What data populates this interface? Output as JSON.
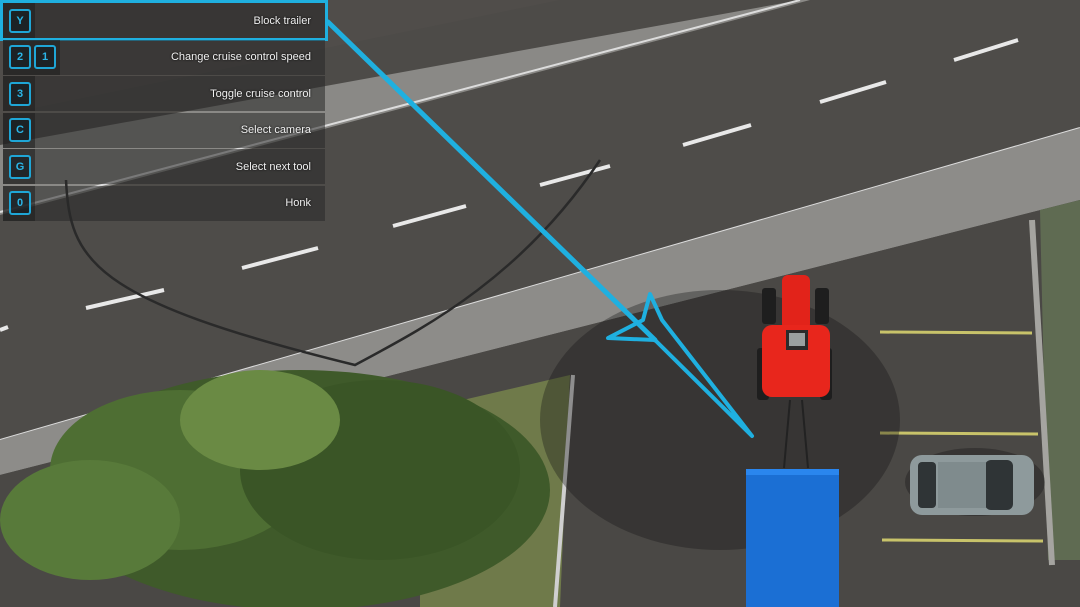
{
  "hud": {
    "bindings": [
      {
        "keys": [
          "Y"
        ],
        "label": "Block trailer",
        "selected": true
      },
      {
        "keys": [
          "2",
          "1"
        ],
        "label": "Change cruise control speed",
        "selected": false
      },
      {
        "keys": [
          "3"
        ],
        "label": "Toggle cruise control",
        "selected": false
      },
      {
        "keys": [
          "C"
        ],
        "label": "Select camera",
        "selected": false
      },
      {
        "keys": [
          "G"
        ],
        "label": "Select next tool",
        "selected": false
      },
      {
        "keys": [
          "0"
        ],
        "label": "Honk",
        "selected": false
      }
    ],
    "accent_color": "#1fb0e0"
  },
  "scene": {
    "vehicle": "red-tractor",
    "trailer": "blue-trailer",
    "parked_car": "grey-hatchback",
    "tutorial_arrow": "pointer-arrow"
  }
}
